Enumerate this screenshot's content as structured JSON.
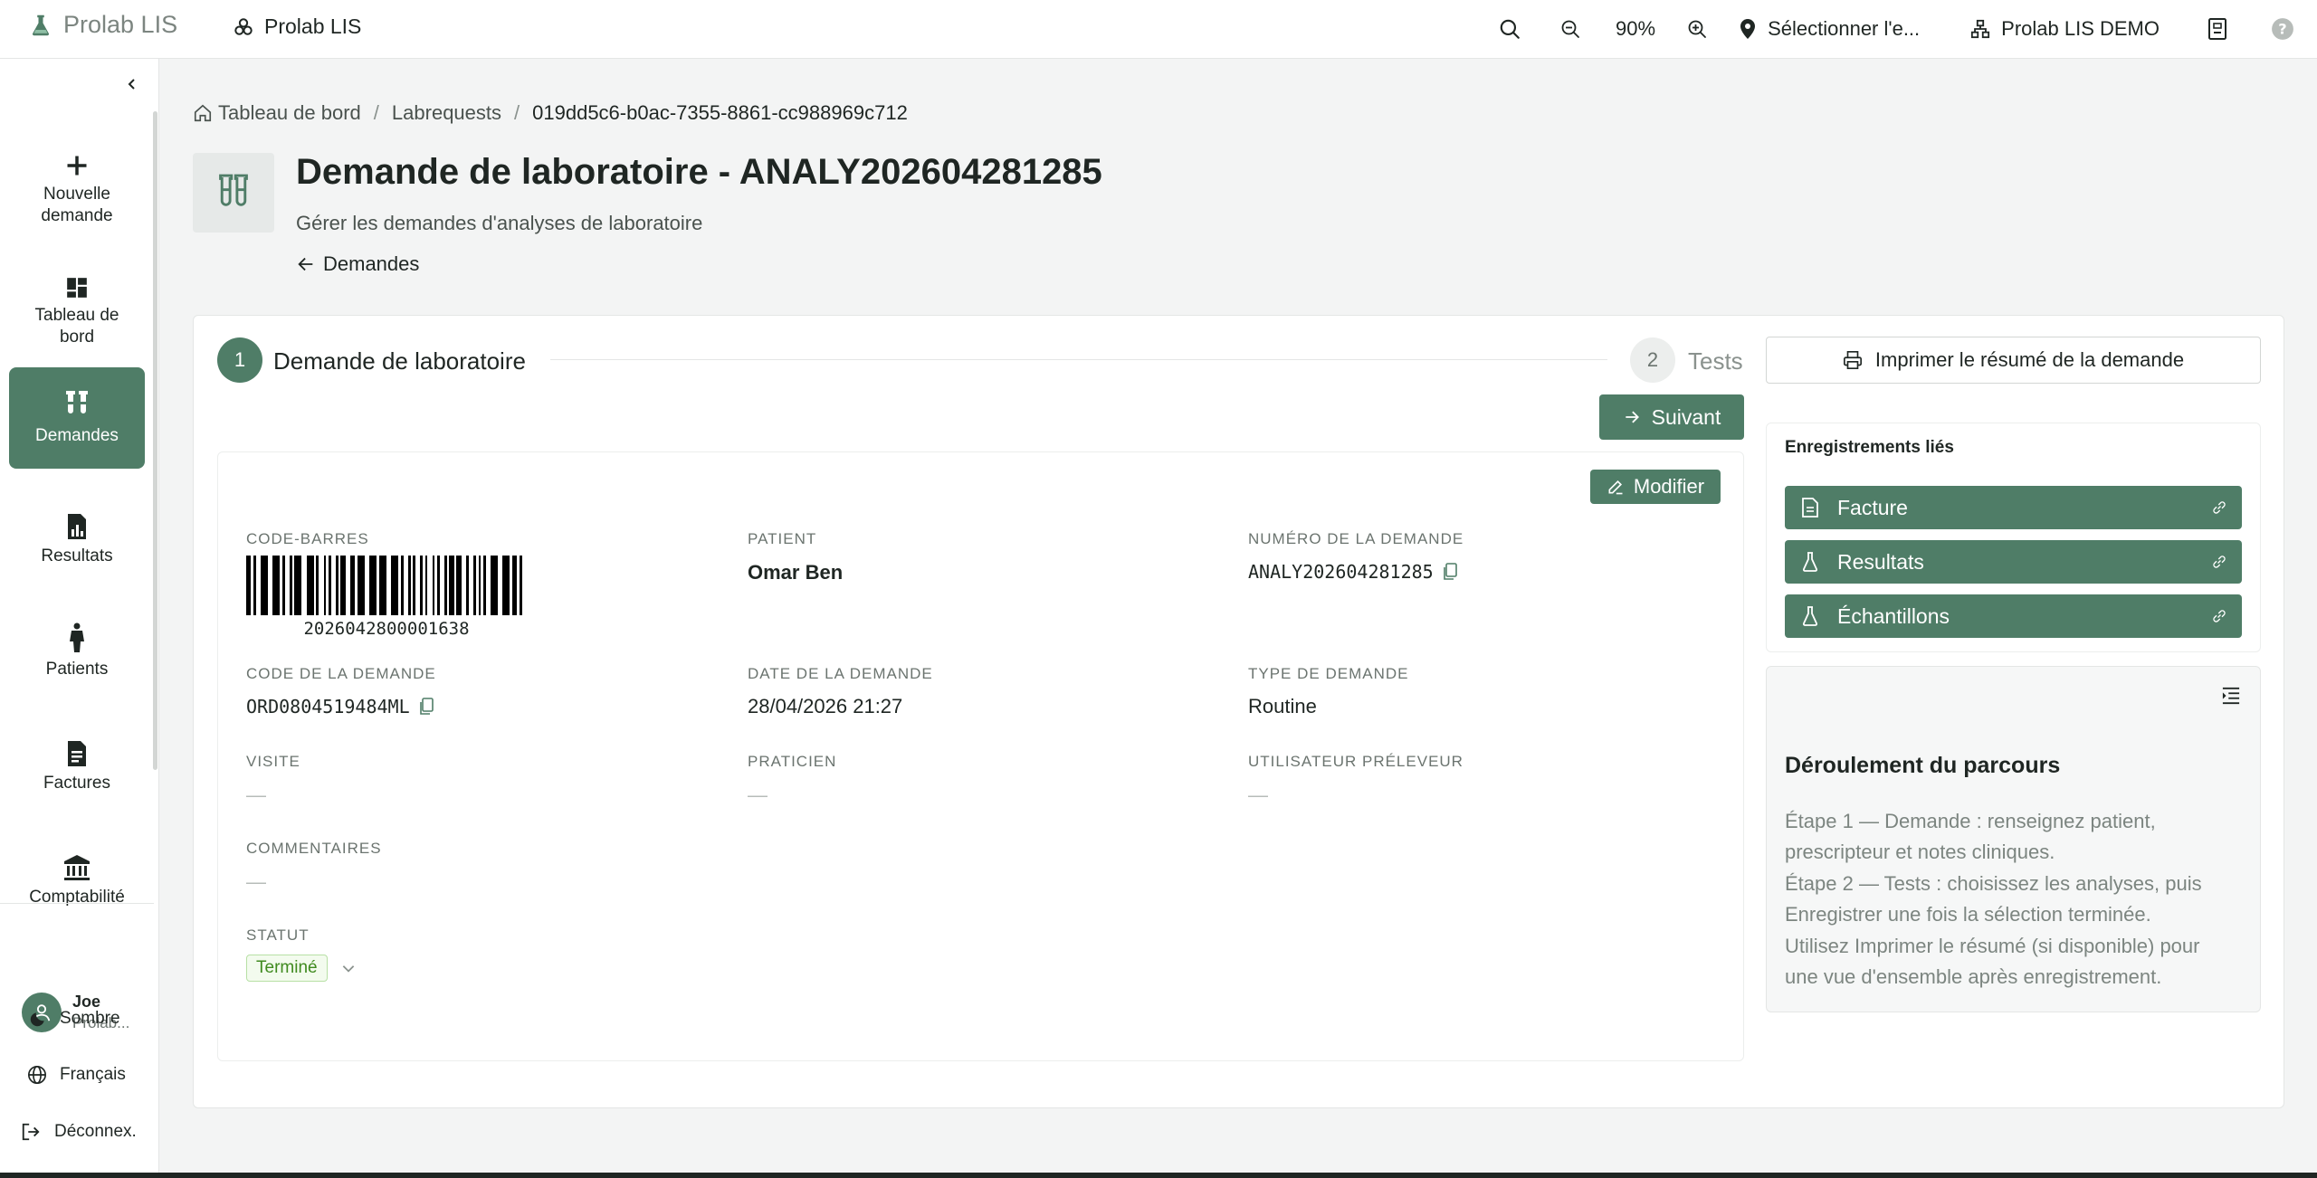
{
  "topbar": {
    "brand": "Prolab LIS",
    "app_name": "Prolab LIS",
    "zoom": "90%",
    "location_label": "Sélectionner l'e...",
    "org_label": "Prolab LIS DEMO"
  },
  "sidebar": {
    "items": [
      {
        "label": "Nouvelle demande",
        "icon": "plus-icon"
      },
      {
        "label": "Tableau de bord",
        "icon": "dashboard-icon"
      },
      {
        "label": "Demandes",
        "icon": "test-tubes-icon",
        "active": true
      },
      {
        "label": "Resultats",
        "icon": "report-icon"
      },
      {
        "label": "Patients",
        "icon": "person-icon"
      },
      {
        "label": "Factures",
        "icon": "invoice-icon"
      },
      {
        "label": "Comptabilité",
        "icon": "bank-icon"
      }
    ],
    "user": {
      "name": "Joe",
      "org": "Prolab..."
    },
    "theme_label": "Sombre",
    "language_label": "Français",
    "logout_label": "Déconnex."
  },
  "breadcrumb": {
    "home": "Tableau de bord",
    "section": "Labrequests",
    "current": "019dd5c6-b0ac-7355-8861-cc988969c712"
  },
  "header": {
    "title": "Demande de laboratoire - ANALY202604281285",
    "subtitle": "Gérer les demandes d'analyses de laboratoire",
    "back_label": "Demandes"
  },
  "stepper": {
    "step1_num": "1",
    "step1_label": "Demande de laboratoire",
    "step2_num": "2",
    "step2_label": "Tests",
    "next_label": "Suivant"
  },
  "details": {
    "edit_label": "Modifier",
    "barcode_label": "CODE-BARRES",
    "barcode_value": "2026042800001638",
    "patient_label": "PATIENT",
    "patient_value": "Omar Ben",
    "request_number_label": "NUMÉRO DE LA DEMANDE",
    "request_number_value": "ANALY202604281285",
    "request_code_label": "CODE DE LA DEMANDE",
    "request_code_value": "ORD0804519484ML",
    "request_date_label": "DATE DE LA DEMANDE",
    "request_date_value": "28/04/2026 21:27",
    "request_type_label": "TYPE DE DEMANDE",
    "request_type_value": "Routine",
    "visit_label": "VISITE",
    "visit_value": "—",
    "practitioner_label": "PRATICIEN",
    "practitioner_value": "—",
    "collector_label": "UTILISATEUR PRÉLEVEUR",
    "collector_value": "—",
    "comments_label": "COMMENTAIRES",
    "comments_value": "—",
    "status_label": "STATUT",
    "status_value": "Terminé"
  },
  "right_panel": {
    "print_label": "Imprimer le résumé de la demande",
    "linked_title": "Enregistrements liés",
    "linked_items": [
      {
        "label": "Facture",
        "icon": "document-icon"
      },
      {
        "label": "Resultats",
        "icon": "flask-icon"
      },
      {
        "label": "Échantillons",
        "icon": "flask-icon"
      }
    ],
    "guide_title": "Déroulement du parcours",
    "guide_lines": [
      "Étape 1 — Demande : renseignez patient,",
      "prescripteur et notes cliniques.",
      "Étape 2 — Tests : choisissez les analyses, puis",
      "Enregistrer une fois la sélection terminée.",
      "Utilisez Imprimer le résumé (si disponible) pour",
      "une vue d'ensemble après enregistrement."
    ]
  },
  "colors": {
    "accent": "#4f7d67",
    "status_green": "#3f8a1f",
    "page_bg": "#f3f4f4"
  }
}
